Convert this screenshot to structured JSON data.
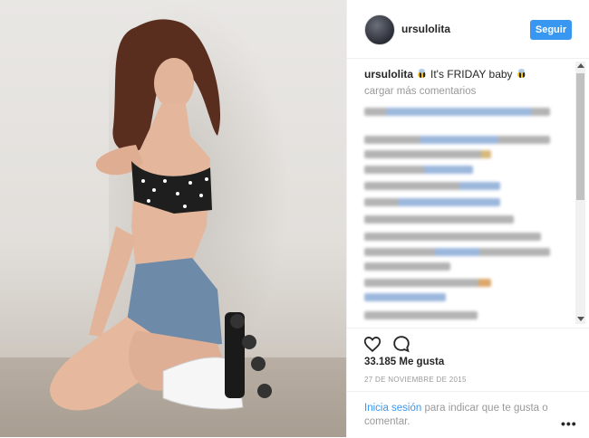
{
  "post": {
    "username": "ursulolita",
    "follow_label": "Seguir",
    "caption_text": "It's FRIDAY baby",
    "load_more": "cargar más comentarios",
    "likes": "33.185 Me gusta",
    "date": "27 DE NOVIEMBRE DE 2015",
    "login_link": "Inicia sesión",
    "login_rest": " para indicar que te gusta o comentar.",
    "more_label": "•••"
  },
  "icons": [
    "bee-icon",
    "heart-icon",
    "comment-icon",
    "more-options-icon",
    "scroll-up-icon",
    "scroll-down-icon"
  ],
  "colors": {
    "accent": "#3897f0",
    "muted": "#999999",
    "text": "#262626"
  }
}
